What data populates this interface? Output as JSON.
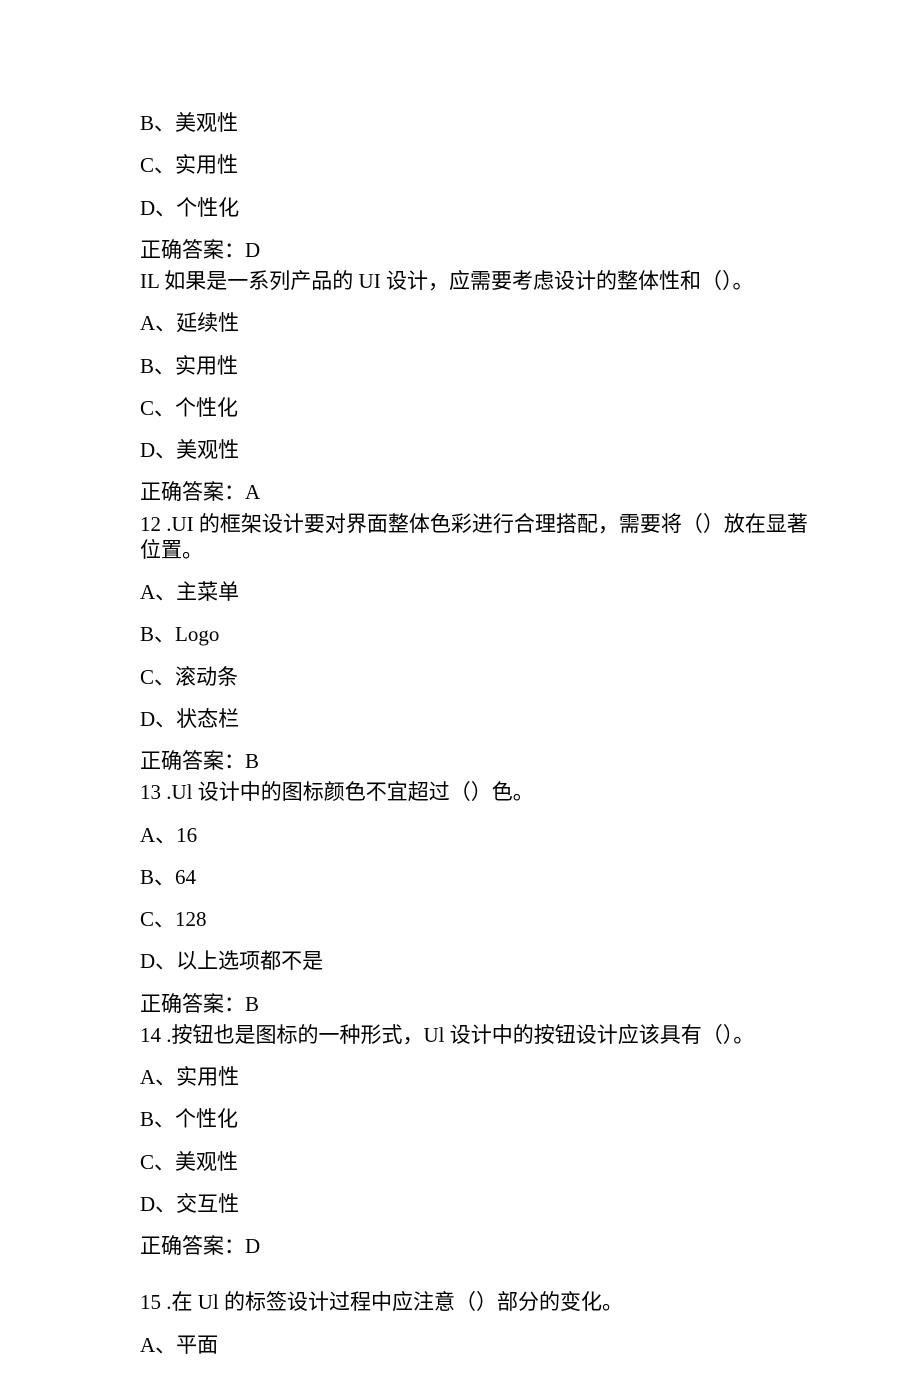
{
  "q10": {
    "opt_b": "B、美观性",
    "opt_c": "C、实用性",
    "opt_d": "D、个性化",
    "answer": "正确答案：D"
  },
  "q11": {
    "stem": "IL 如果是一系列产品的 UI 设计，应需要考虑设计的整体性和（）。",
    "opt_a": "A、延续性",
    "opt_b": "B、实用性",
    "opt_c": "C、个性化",
    "opt_d": "D、美观性",
    "answer": "正确答案：A"
  },
  "q12": {
    "stem": "12 .UI 的框架设计要对界面整体色彩进行合理搭配，需要将（）放在显著位置。",
    "opt_a": "A、主菜单",
    "opt_b": "B、Logo",
    "opt_c": "C、滚动条",
    "opt_d": "D、状态栏",
    "answer": "正确答案：B"
  },
  "q13": {
    "stem": "13 .Ul 设计中的图标颜色不宜超过（）色。",
    "opt_a": "A、16",
    "opt_b": "B、64",
    "opt_c": "C、128",
    "opt_d": "D、以上选项都不是",
    "answer": "正确答案：B"
  },
  "q14": {
    "stem": "14 .按钮也是图标的一种形式，Ul 设计中的按钮设计应该具有（）。",
    "opt_a": "A、实用性",
    "opt_b": "B、个性化",
    "opt_c": "C、美观性",
    "opt_d": "D、交互性",
    "answer": "正确答案：D"
  },
  "q15": {
    "stem": "15 .在 Ul 的标签设计过程中应注意（）部分的变化。",
    "opt_a": "A、平面"
  }
}
